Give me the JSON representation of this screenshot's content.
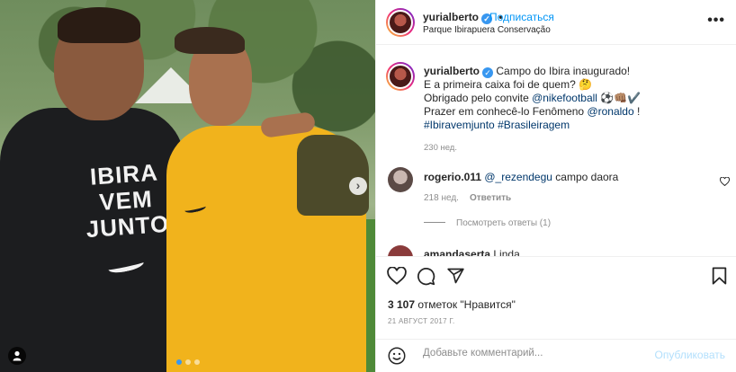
{
  "photo": {
    "shirt_print": [
      "IBIRA",
      "VEM",
      "JUNTO"
    ],
    "carousel_count": 3,
    "carousel_active": 1
  },
  "header": {
    "username": "yurialberto",
    "follow_label": "Подписаться",
    "separator": "•",
    "location": "Parque Ibirapuera Conservação",
    "more_glyph": "•••"
  },
  "caption": {
    "username": "yurialberto",
    "line1": "Campo do Ibira inaugurado!",
    "line2": "E a primeira caixa foi de quem? 🤔",
    "line3_prefix": "Obrigado pelo convite ",
    "line3_mention": "@nikefootball",
    "line3_emoji": " ⚽👊🏽✔️",
    "line4_prefix": "Prazer em conhecê-lo Fenômeno ",
    "line4_mention": "@ronaldo",
    "line4_suffix": " !",
    "hashtag1": "#Ibiravemjunto",
    "hashtag2": "#Brasileiragem",
    "time": "230 нед."
  },
  "comment1": {
    "username": "rogerio.011",
    "mention": "@_rezendegu",
    "text": " campo daora",
    "time": "218 нед.",
    "reply_label": "Ответить",
    "view_replies": "Посмотреть ответы (1)"
  },
  "comment2": {
    "username": "amandaserta",
    "text": " Linda"
  },
  "actions": {
    "likes_count": "3 107",
    "likes_suffix": " отметок \"Нравится\"",
    "date": "21 АВГУСТ 2017 Г."
  },
  "add_comment": {
    "placeholder": "Добавьте комментарий...",
    "publish_label": "Опубликовать"
  },
  "colors": {
    "accent": "#0095f6",
    "link": "#00376b",
    "muted": "#8e8e8e",
    "publish_disabled": "#b2dffc"
  },
  "icons": [
    "tag-user-icon",
    "next-arrow-icon",
    "more-icon",
    "verified-icon",
    "heart-icon",
    "comment-icon",
    "share-icon",
    "bookmark-icon",
    "emoji-icon"
  ]
}
